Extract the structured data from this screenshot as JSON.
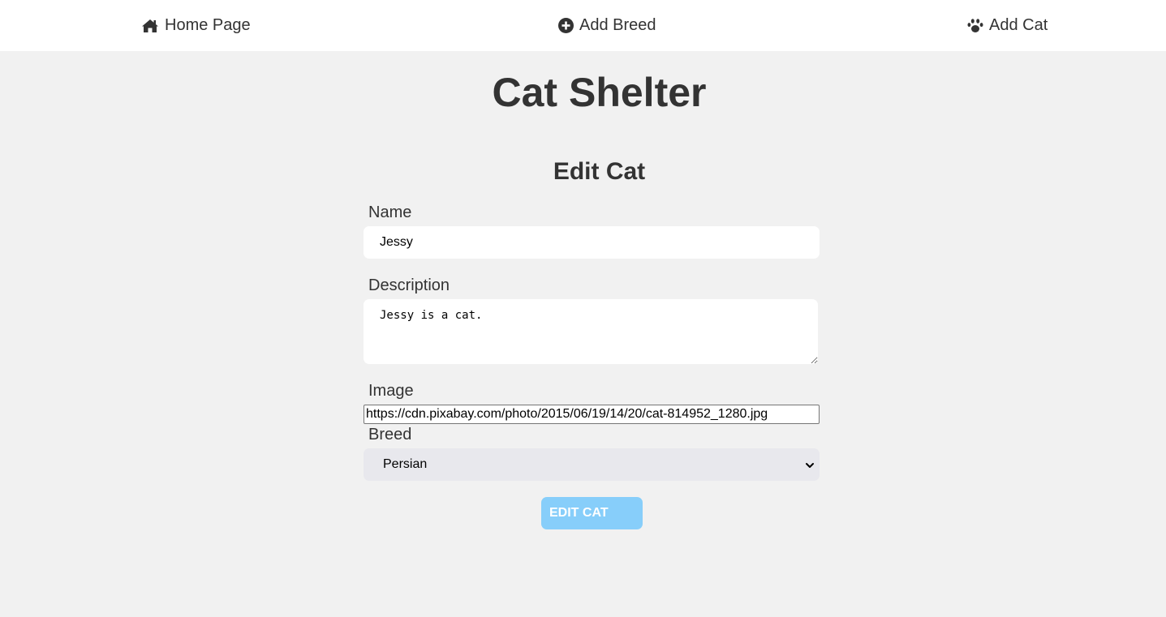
{
  "nav": {
    "home_label": "Home Page",
    "add_breed_label": "Add Breed",
    "add_cat_label": "Add Cat",
    "icons": [
      "home-icon",
      "plus-circle-icon",
      "paw-icon"
    ]
  },
  "site_title": "Cat Shelter",
  "form": {
    "title": "Edit Cat",
    "name_label": "Name",
    "name_value": "Jessy",
    "description_label": "Description",
    "description_value": "Jessy is a cat.",
    "image_label": "Image",
    "image_value": "https://cdn.pixabay.com/photo/2015/06/19/14/20/cat-814952_1280.jpg",
    "breed_label": "Breed",
    "breed_selected": "Persian",
    "submit_label": "EDIT CAT"
  },
  "colors": {
    "background": "#f1f1f1",
    "navbar": "#ffffff",
    "text": "#333333",
    "button": "#87cefa",
    "select": "#e8e8ed"
  }
}
